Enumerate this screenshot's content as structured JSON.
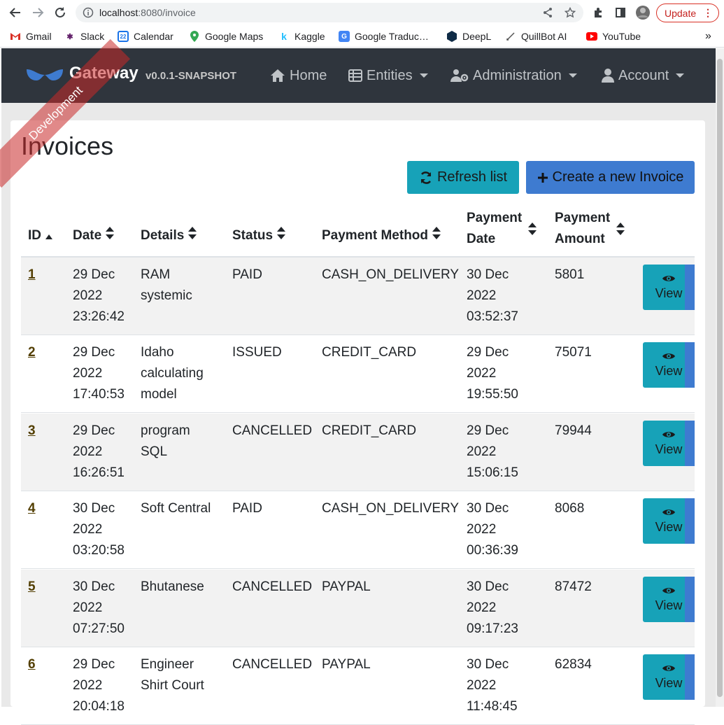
{
  "browser": {
    "url_host": "localhost",
    "url_rest": ":8080/invoice",
    "update_label": "Update",
    "bookmarks": [
      "Gmail",
      "Slack",
      "Calendar",
      "Google Maps",
      "Kaggle",
      "Google Traduc…",
      "DeepL",
      "QuillBot AI",
      "YouTube"
    ],
    "more": "»"
  },
  "nav": {
    "brand": "Gateway",
    "version": "v0.0.1-SNAPSHOT",
    "home": "Home",
    "entities": "Entities",
    "administration": "Administration",
    "account": "Account",
    "ribbon": "Development"
  },
  "page": {
    "title": "Invoices",
    "refresh": "Refresh list",
    "create": "Create a new Invoice"
  },
  "table": {
    "headers": {
      "id": "ID",
      "date": "Date",
      "details": "Details",
      "status": "Status",
      "method": "Payment Method",
      "paydate_1": "Payment",
      "paydate_2": "Date",
      "payamount_1": "Payment",
      "payamount_2": "Amount"
    },
    "view_label": "View",
    "rows": [
      {
        "id": "1",
        "date": [
          "29 Dec",
          "2022",
          "23:26:42"
        ],
        "details": [
          "RAM",
          "systemic"
        ],
        "status": "PAID",
        "method": "CASH_ON_DELIVERY",
        "paydate": [
          "30 Dec",
          "2022",
          "03:52:37"
        ],
        "amount": "5801"
      },
      {
        "id": "2",
        "date": [
          "29 Dec",
          "2022",
          "17:40:53"
        ],
        "details": [
          "Idaho",
          "calculating",
          "model"
        ],
        "status": "ISSUED",
        "method": "CREDIT_CARD",
        "paydate": [
          "29 Dec",
          "2022",
          "19:55:50"
        ],
        "amount": "75071"
      },
      {
        "id": "3",
        "date": [
          "29 Dec",
          "2022",
          "16:26:51"
        ],
        "details": [
          "program",
          "SQL"
        ],
        "status": "CANCELLED",
        "method": "CREDIT_CARD",
        "paydate": [
          "29 Dec",
          "2022",
          "15:06:15"
        ],
        "amount": "79944"
      },
      {
        "id": "4",
        "date": [
          "30 Dec",
          "2022",
          "03:20:58"
        ],
        "details": [
          "Soft Central"
        ],
        "status": "PAID",
        "method": "CASH_ON_DELIVERY",
        "paydate": [
          "30 Dec",
          "2022",
          "00:36:39"
        ],
        "amount": "8068"
      },
      {
        "id": "5",
        "date": [
          "30 Dec",
          "2022",
          "07:27:50"
        ],
        "details": [
          "Bhutanese"
        ],
        "status": "CANCELLED",
        "method": "PAYPAL",
        "paydate": [
          "30 Dec",
          "2022",
          "09:17:23"
        ],
        "amount": "87472"
      },
      {
        "id": "6",
        "date": [
          "29 Dec",
          "2022",
          "20:04:18"
        ],
        "details": [
          "Engineer",
          "Shirt Court"
        ],
        "status": "CANCELLED",
        "method": "PAYPAL",
        "paydate": [
          "30 Dec",
          "2022",
          "11:48:45"
        ],
        "amount": "62834"
      }
    ]
  }
}
